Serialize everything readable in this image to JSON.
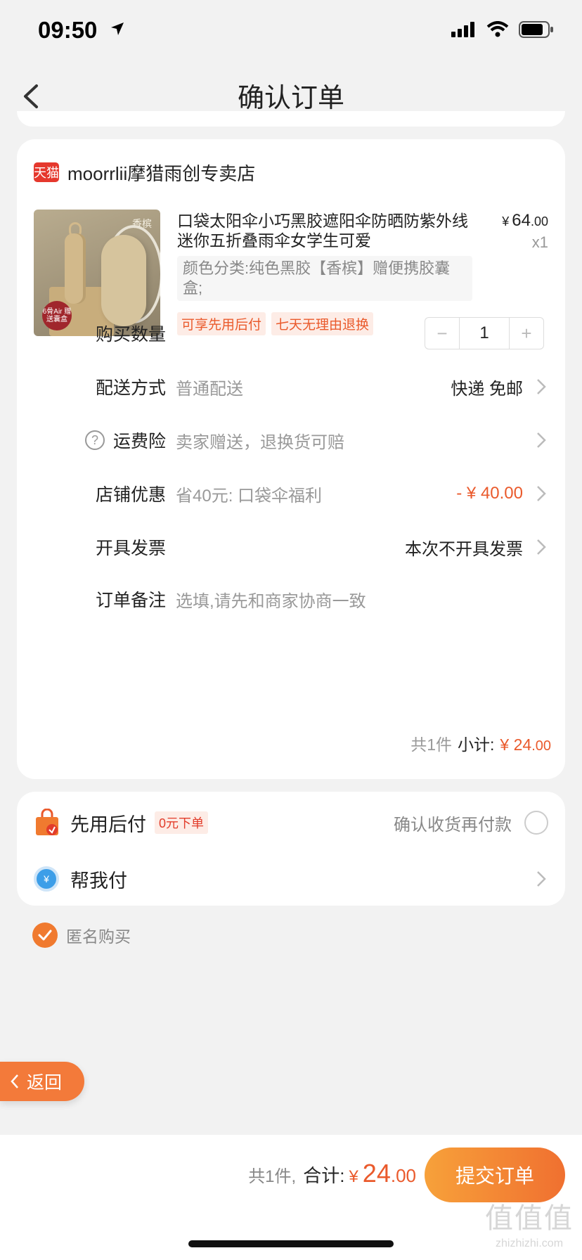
{
  "status_bar": {
    "time": "09:50"
  },
  "nav": {
    "title": "确认订单"
  },
  "shop": {
    "badge": "天猫",
    "name": "moorrlii摩猎雨创专卖店"
  },
  "product": {
    "image_tag": "香槟",
    "image_seal": "6骨Air 赠送囊盒",
    "title": "口袋太阳伞小巧黑胶遮阳伞防晒防紫外线迷你五折叠雨伞女学生可爱",
    "price_yen": "¥",
    "price_int": "64",
    "price_dec": ".00",
    "qty": "x1",
    "sku": "颜色分类:纯色黑胶【香槟】赠便携胶囊盒;",
    "tags": [
      "可享先用后付",
      "七天无理由退换"
    ]
  },
  "rows": {
    "quantity": {
      "label": "购买数量",
      "minus": "−",
      "value": "1",
      "plus": "+"
    },
    "delivery": {
      "label": "配送方式",
      "value": "普通配送",
      "right": "快递 免邮"
    },
    "insurance": {
      "icon": "?",
      "label": "运费险",
      "value": "卖家赠送，退换货可赔"
    },
    "discount": {
      "label": "店铺优惠",
      "value": "省40元: 口袋伞福利",
      "right": "- ¥ 40.00"
    },
    "invoice": {
      "label": "开具发票",
      "right": "本次不开具发票"
    },
    "note": {
      "label": "订单备注",
      "placeholder": "选填,请先和商家协商一致"
    }
  },
  "subtotal": {
    "count": "共1件",
    "label": "小计:",
    "yen": "¥",
    "int": "24",
    "dec": ".00"
  },
  "payment": {
    "later_title": "先用后付",
    "later_tag": "0元下单",
    "later_hint": "确认收货再付款",
    "help_icon": "¥",
    "help_title": "帮我付"
  },
  "anonymous": {
    "label": "匿名购买",
    "checked": true
  },
  "return_button": {
    "label": "返回"
  },
  "bottom": {
    "count": "共1件,",
    "label": "合计:",
    "yen": "¥",
    "int": "24",
    "dec": ".00",
    "submit": "提交订单"
  },
  "watermark": {
    "logo": "值值值",
    "url": "zhizhizhi.com"
  },
  "colors": {
    "accent": "#ea5a2c",
    "submit_start": "#f7a13a",
    "submit_end": "#f07030",
    "tmall_red": "#e5382d"
  }
}
